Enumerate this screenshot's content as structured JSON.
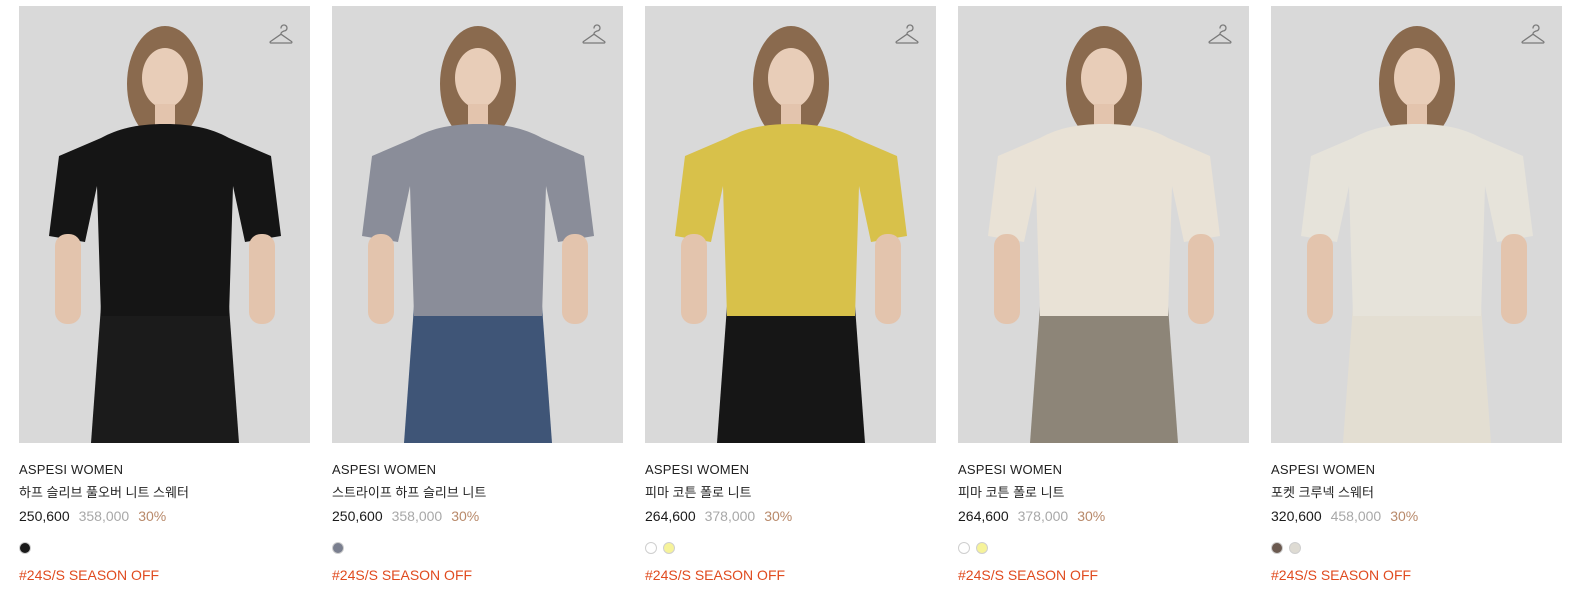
{
  "colors": {
    "image_bg": "#d9d9d9",
    "discount": "#b8896a",
    "tag": "#e04b1f",
    "original_price": "#a8a8a8"
  },
  "products": [
    {
      "brand": "ASPESI WOMEN",
      "name": "하프 슬리브 풀오버 니트 스웨터",
      "sale_price": "250,600",
      "original_price": "358,000",
      "discount": "30%",
      "swatches": [
        "#1a1a1a"
      ],
      "tag": "#24S/S SEASON OFF",
      "top_color": "#151515",
      "bottom_color": "#1b1b1b",
      "icon": "hanger-icon"
    },
    {
      "brand": "ASPESI WOMEN",
      "name": "스트라이프 하프 슬리브 니트",
      "sale_price": "250,600",
      "original_price": "358,000",
      "discount": "30%",
      "swatches": [
        "#7a7f8f"
      ],
      "tag": "#24S/S SEASON OFF",
      "top_color": "#8a8d99",
      "bottom_color": "#3f5577",
      "icon": "hanger-icon"
    },
    {
      "brand": "ASPESI WOMEN",
      "name": "피마 코튼 폴로 니트",
      "sale_price": "264,600",
      "original_price": "378,000",
      "discount": "30%",
      "swatches": [
        "#ffffff",
        "#f6f39a"
      ],
      "tag": "#24S/S SEASON OFF",
      "top_color": "#d8c14a",
      "bottom_color": "#161616",
      "icon": "hanger-icon"
    },
    {
      "brand": "ASPESI WOMEN",
      "name": "피마 코튼 폴로 니트",
      "sale_price": "264,600",
      "original_price": "378,000",
      "discount": "30%",
      "swatches": [
        "#ffffff",
        "#f6f39a"
      ],
      "tag": "#24S/S SEASON OFF",
      "top_color": "#e9e2d6",
      "bottom_color": "#8d8578",
      "icon": "hanger-icon"
    },
    {
      "brand": "ASPESI WOMEN",
      "name": "포켓 크루넥 스웨터",
      "sale_price": "320,600",
      "original_price": "458,000",
      "discount": "30%",
      "swatches": [
        "#6b5a50",
        "#dedbd3"
      ],
      "tag": "#24S/S SEASON OFF",
      "top_color": "#e6e3da",
      "bottom_color": "#e3ded2",
      "icon": "hanger-icon"
    }
  ]
}
